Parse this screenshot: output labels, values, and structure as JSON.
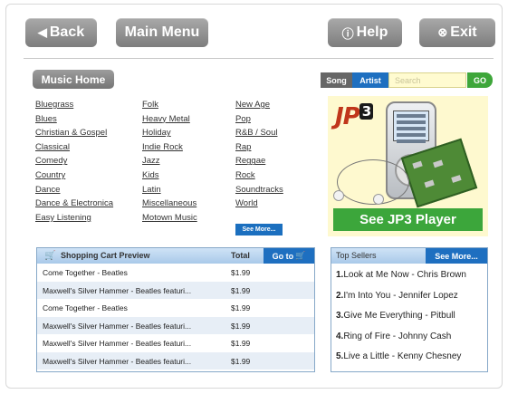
{
  "nav": {
    "back_label": "Back",
    "main_menu_label": "Main Menu",
    "help_label": "Help",
    "exit_label": "Exit"
  },
  "music_home_label": "Music Home",
  "genres": {
    "col1": [
      "Bluegrass",
      "Blues",
      "Christian & Gospel",
      "Classical",
      "Comedy",
      "Country",
      "Dance",
      "Dance & Electronica",
      "Easy Listening"
    ],
    "col2": [
      "Folk",
      "Heavy Metal",
      "Holiday",
      "Indie Rock",
      "Jazz",
      "Kids",
      "Latin",
      "Miscellaneous",
      "Motown Music"
    ],
    "col3": [
      "New Age",
      "Pop",
      "R&B / Soul",
      "Rap",
      "Reggae",
      "Rock",
      "Soundtracks",
      "World"
    ],
    "see_more_label": "See More..."
  },
  "search": {
    "song_label": "Song",
    "artist_label": "Artist",
    "placeholder": "Search",
    "go_label": "GO"
  },
  "ad": {
    "logo_text": "JP",
    "logo_num": "3",
    "button_label": "See JP3 Player"
  },
  "cart": {
    "title": "Shopping Cart Preview",
    "total_label": "Total",
    "goto_label": "Go to",
    "rows": [
      {
        "name": "Come Together - Beatles",
        "price": "$1.99"
      },
      {
        "name": "Maxwell's Silver Hammer - Beatles featuri...",
        "price": "$1.99"
      },
      {
        "name": "Come Together - Beatles",
        "price": "$1.99"
      },
      {
        "name": "Maxwell's Silver Hammer - Beatles featuri...",
        "price": "$1.99"
      },
      {
        "name": "Maxwell's Silver Hammer - Beatles featuri...",
        "price": "$1.99"
      },
      {
        "name": "Maxwell's Silver Hammer - Beatles featuri...",
        "price": "$1.99"
      }
    ]
  },
  "top_sellers": {
    "title": "Top Sellers",
    "see_more_label": "See More...",
    "items": [
      {
        "rank": "1.",
        "text": "Look at Me Now - Chris Brown"
      },
      {
        "rank": "2.",
        "text": "I'm Into You - Jennifer Lopez"
      },
      {
        "rank": "3.",
        "text": "Give Me Everything - Pitbull"
      },
      {
        "rank": "4.",
        "text": "Ring of Fire - Johnny Cash"
      },
      {
        "rank": "5.",
        "text": "Live a Little - Kenny Chesney"
      }
    ]
  },
  "colors": {
    "accent_blue": "#1e6fc0",
    "accent_green": "#3ca63b",
    "button_gray": "#8a8a8a"
  }
}
